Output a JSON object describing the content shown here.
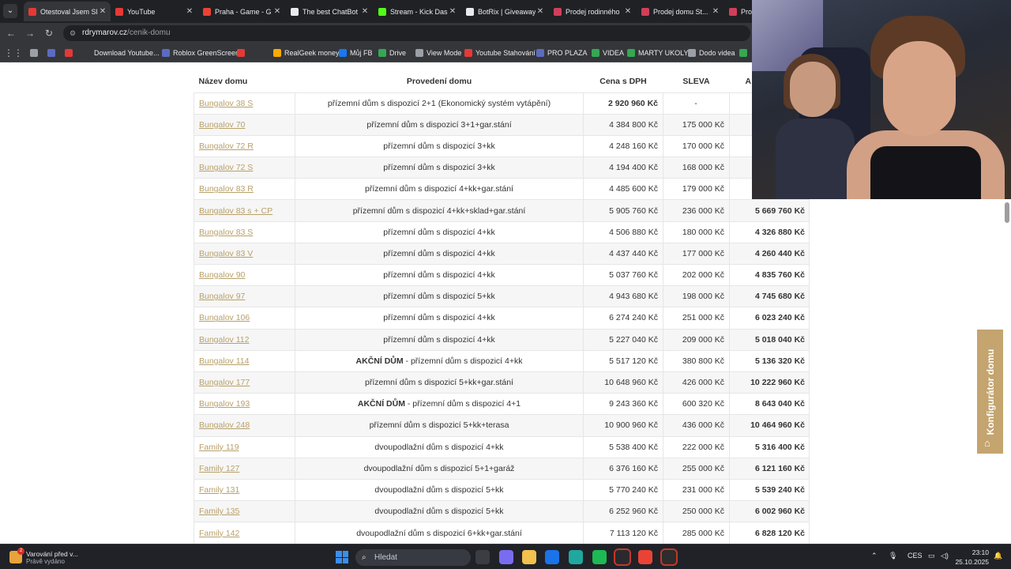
{
  "browser": {
    "tabs": [
      {
        "title": "Otestoval Jsem Sl",
        "color": "#e53935"
      },
      {
        "title": "YouTube",
        "color": "#e53935"
      },
      {
        "title": "Praha - Game - G",
        "color": "#ea4335"
      },
      {
        "title": "The best ChatBot",
        "color": "#e8eaed"
      },
      {
        "title": "Stream - Kick Das",
        "color": "#53fc18"
      },
      {
        "title": "BotRix | Giveaway",
        "color": "#e8eaed"
      },
      {
        "title": "Prodej rodinného",
        "color": "#d13f5a"
      },
      {
        "title": "Prodej domu St...",
        "color": "#d13f5a"
      },
      {
        "title": "Prod",
        "color": "#d13f5a"
      }
    ],
    "url_domain": "rdrymarov.cz",
    "url_path": "/cenik-domu",
    "bookmarks": [
      {
        "label": "",
        "color": "#9aa0a6"
      },
      {
        "label": "",
        "color": "#5c6bc0"
      },
      {
        "label": "",
        "color": "#e53935"
      },
      {
        "label": "Download Youtube...",
        "color": "#35363a"
      },
      {
        "label": "Roblox GreenScreen",
        "color": "#5c6bc0"
      },
      {
        "label": "",
        "color": "#e53935"
      },
      {
        "label": "RealGeek money",
        "color": "#f9ab00"
      },
      {
        "label": "Můj FB",
        "color": "#1877f2"
      },
      {
        "label": "Drive",
        "color": "#34a853"
      },
      {
        "label": "View Mode",
        "color": "#9aa0a6"
      },
      {
        "label": "Youtube Stahování",
        "color": "#e53935"
      },
      {
        "label": "PRO PLAZA",
        "color": "#5c6bc0"
      },
      {
        "label": "VIDEA",
        "color": "#34a853"
      },
      {
        "label": "MARTY UKOLY",
        "color": "#34a853"
      },
      {
        "label": "Dodo videa",
        "color": "#9aa0a6"
      },
      {
        "label": "",
        "color": "#34a853"
      }
    ]
  },
  "table": {
    "headers": [
      "Název domu",
      "Provedení domu",
      "Cena s DPH",
      "SLEVA",
      "A"
    ],
    "rows": [
      {
        "name": "Bungalov 38 S",
        "tag": "",
        "desc": "přízemní dům s dispozicí 2+1 (Ekonomický systém vytápění)",
        "price": "2 920 960 Kč",
        "discount": "-",
        "final": "",
        "price_bold": true
      },
      {
        "name": "Bungalov 70",
        "tag": "",
        "desc": "přízemní dům s dispozicí 3+1+gar.stání",
        "price": "4 384 800 Kč",
        "discount": "175 000 Kč",
        "final": ""
      },
      {
        "name": "Bungalov 72 R",
        "tag": "",
        "desc": "přízemní dům s dispozicí 3+kk",
        "price": "4 248 160 Kč",
        "discount": "170 000 Kč",
        "final": ""
      },
      {
        "name": "Bungalov 72 S",
        "tag": "",
        "desc": "přízemní dům s dispozicí 3+kk",
        "price": "4 194 400 Kč",
        "discount": "168 000 Kč",
        "final": ""
      },
      {
        "name": "Bungalov 83 R",
        "tag": "",
        "desc": "přízemní dům s dispozicí 4+kk+gar.stání",
        "price": "4 485 600 Kč",
        "discount": "179 000 Kč",
        "final": ""
      },
      {
        "name": "Bungalov 83 s + CP",
        "tag": "",
        "desc": "přízemní dům s dispozicí 4+kk+sklad+gar.stání",
        "price": "5 905 760 Kč",
        "discount": "236 000 Kč",
        "final": "5 669 760 Kč"
      },
      {
        "name": "Bungalov 83 S",
        "tag": "",
        "desc": "přízemní dům s dispozicí 4+kk",
        "price": "4 506 880 Kč",
        "discount": "180 000 Kč",
        "final": "4 326 880 Kč"
      },
      {
        "name": "Bungalov 83 V",
        "tag": "",
        "desc": "přízemní dům s dispozicí 4+kk",
        "price": "4 437 440 Kč",
        "discount": "177 000 Kč",
        "final": "4 260 440 Kč"
      },
      {
        "name": "Bungalov 90",
        "tag": "",
        "desc": "přízemní dům s dispozicí 4+kk",
        "price": "5 037 760 Kč",
        "discount": "202 000 Kč",
        "final": "4 835 760 Kč"
      },
      {
        "name": "Bungalov 97",
        "tag": "",
        "desc": "přízemní dům s dispozicí 5+kk",
        "price": "4 943 680 Kč",
        "discount": "198 000 Kč",
        "final": "4 745 680 Kč"
      },
      {
        "name": "Bungalov 106",
        "tag": "",
        "desc": "přízemní dům s dispozicí 4+kk",
        "price": "6 274 240 Kč",
        "discount": "251 000 Kč",
        "final": "6 023 240 Kč"
      },
      {
        "name": "Bungalov 112",
        "tag": "",
        "desc": "přízemní dům s dispozicí 4+kk",
        "price": "5 227 040 Kč",
        "discount": "209 000 Kč",
        "final": "5 018 040 Kč"
      },
      {
        "name": "Bungalov 114",
        "tag": "AKČNÍ DŮM",
        "desc": " - přízemní dům s dispozicí 4+kk",
        "price": "5 517 120 Kč",
        "discount": "380 800 Kč",
        "final": "5 136 320 Kč"
      },
      {
        "name": "Bungalov 177",
        "tag": "",
        "desc": "přízemní dům s dispozicí 5+kk+gar.stání",
        "price": "10 648 960 Kč",
        "discount": "426 000 Kč",
        "final": "10 222 960 Kč"
      },
      {
        "name": "Bungalov 193",
        "tag": "AKČNÍ DŮM",
        "desc": " - přízemní dům s dispozicí 4+1",
        "price": "9 243 360 Kč",
        "discount": "600 320 Kč",
        "final": "8 643 040 Kč"
      },
      {
        "name": "Bungalov 248",
        "tag": "",
        "desc": "přízemní dům s dispozicí 5+kk+terasa",
        "price": "10 900 960 Kč",
        "discount": "436 000 Kč",
        "final": "10 464 960 Kč"
      },
      {
        "name": "Family 119",
        "tag": "",
        "desc": "dvoupodlažní dům s dispozicí 4+kk",
        "price": "5 538 400 Kč",
        "discount": "222 000 Kč",
        "final": "5 316 400 Kč"
      },
      {
        "name": "Family 127",
        "tag": "",
        "desc": "dvoupodlažní dům s dispozicí 5+1+garáž",
        "price": "6 376 160 Kč",
        "discount": "255 000 Kč",
        "final": "6 121 160 Kč"
      },
      {
        "name": "Family 131",
        "tag": "",
        "desc": "dvoupodlažní dům s dispozicí 5+kk",
        "price": "5 770 240 Kč",
        "discount": "231 000 Kč",
        "final": "5 539 240 Kč"
      },
      {
        "name": "Family 135",
        "tag": "",
        "desc": "dvoupodlažní dům s dispozicí 5+kk",
        "price": "6 252 960 Kč",
        "discount": "250 000 Kč",
        "final": "6 002 960 Kč"
      },
      {
        "name": "Family 142",
        "tag": "",
        "desc": "dvoupodlažní dům s dispozicí 6+kk+gar.stání",
        "price": "7 113 120 Kč",
        "discount": "285 000 Kč",
        "final": "6 828 120 Kč"
      }
    ]
  },
  "side_button": {
    "label": "Konfigurátor domu",
    "icon": "house-gear-icon"
  },
  "taskbar": {
    "notification_title": "Varování před v...",
    "notification_sub": "Právě vydáno",
    "notification_count": "2",
    "search_placeholder": "Hledat",
    "apps": [
      {
        "name": "file-explorer-app",
        "color": "#3a3d44"
      },
      {
        "name": "copilot-app",
        "color": "#7a6cf0"
      },
      {
        "name": "folder-app",
        "color": "#f2c14e"
      },
      {
        "name": "outlook-app",
        "color": "#1a73e8"
      },
      {
        "name": "edge-app",
        "color": "#1fa7a0"
      },
      {
        "name": "spotify-app",
        "color": "#1db954"
      },
      {
        "name": "capcut-app",
        "color": "#2a2a2e"
      },
      {
        "name": "chrome-app",
        "color": "#ea4335"
      },
      {
        "name": "epic-games-app",
        "color": "#2d2d2d"
      }
    ],
    "language": "CES",
    "time": "23:10",
    "date": "25.10.2025"
  }
}
